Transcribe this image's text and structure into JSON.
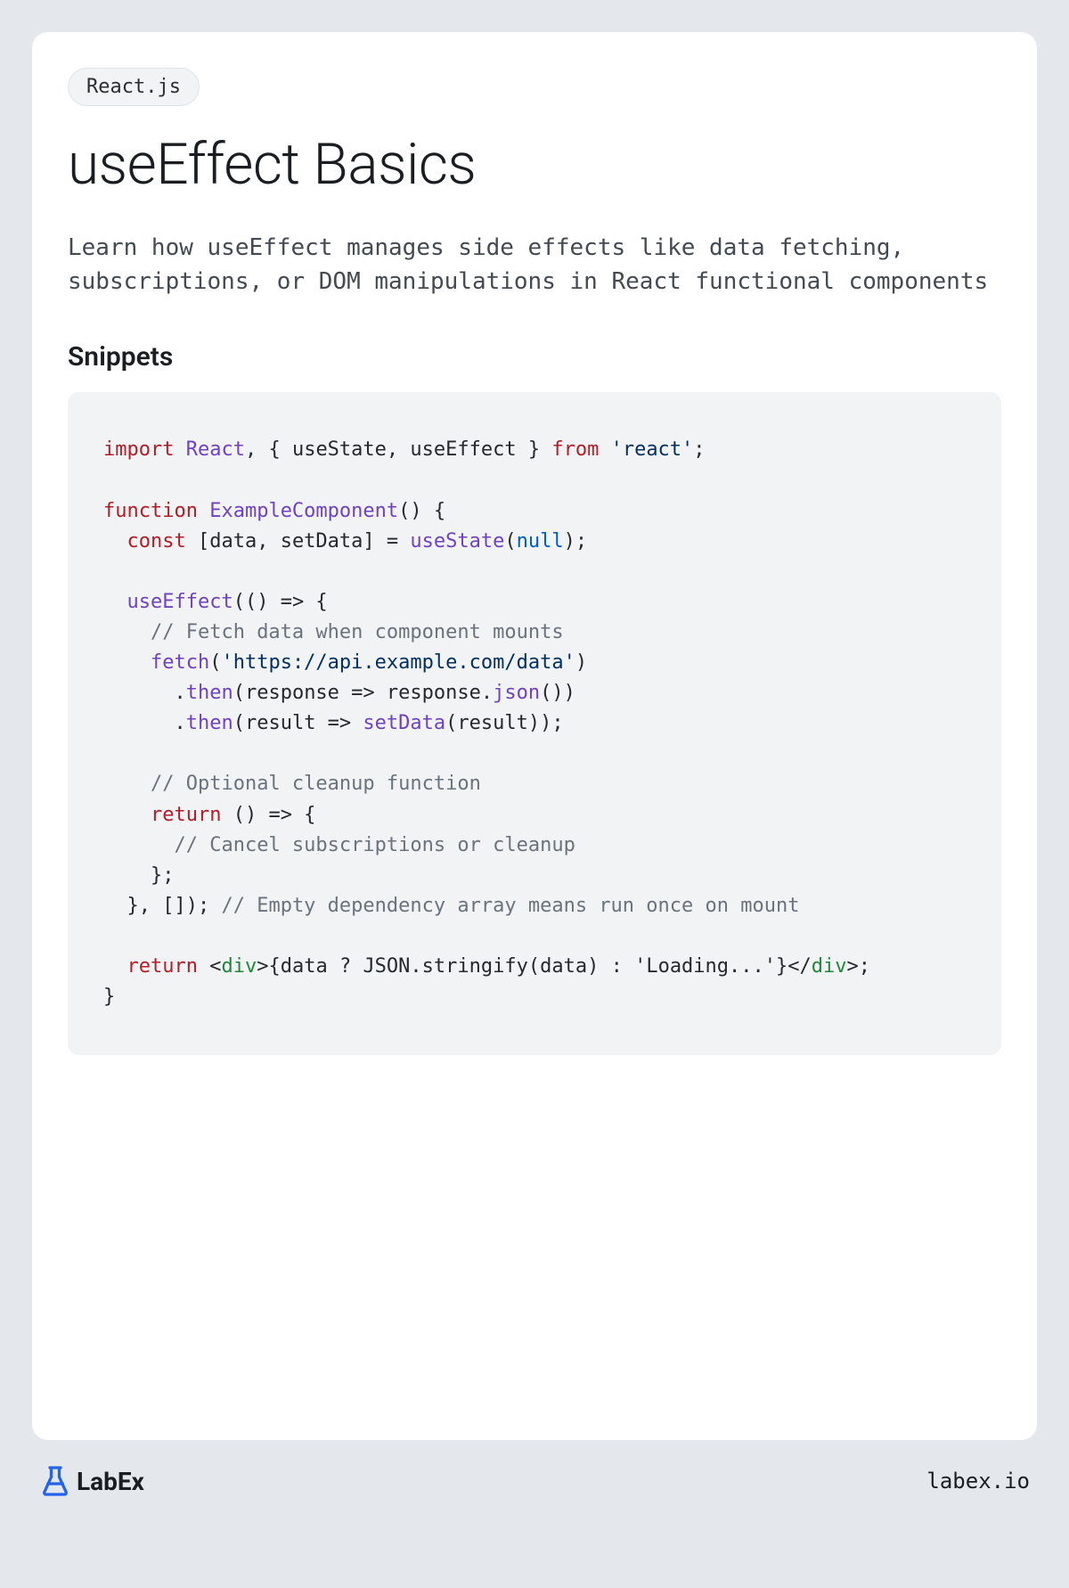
{
  "tag": "React.js",
  "title": "useEffect Basics",
  "description": "Learn how useEffect manages side effects like data fetching, subscriptions, or DOM manipulations in React functional components",
  "section_heading": "Snippets",
  "code": {
    "l1_import": "import",
    "l1_react": "React",
    "l1_rest": ", { useState, useEffect } ",
    "l1_from": "from",
    "l1_str": "'react'",
    "l3_function": "function",
    "l3_name": "ExampleComponent",
    "l3_rest": "() {",
    "l4_const": "const",
    "l4_mid": " [data, setData] = ",
    "l4_usestate": "useState",
    "l4_open": "(",
    "l4_null": "null",
    "l4_close": ");",
    "l6_call": "useEffect",
    "l6_rest": "(() => {",
    "l7_comment": "// Fetch data when component mounts",
    "l8_fetch": "fetch",
    "l8_open": "(",
    "l8_str": "'https://api.example.com/data'",
    "l8_close": ")",
    "l9_pre": "      .",
    "l9_then": "then",
    "l9_mid": "(response => response.",
    "l9_json": "json",
    "l9_end": "())",
    "l10_pre": "      .",
    "l10_then": "then",
    "l10_mid": "(result => ",
    "l10_setdata": "setData",
    "l10_end": "(result));",
    "l12_comment": "// Optional cleanup function",
    "l13_return": "return",
    "l13_rest": " () => {",
    "l14_comment": "// Cancel subscriptions or cleanup",
    "l15": "    };",
    "l16_pre": "  }, []); ",
    "l16_comment": "// Empty dependency array means run once on mount",
    "l18_return": "return",
    "l18_open": " <",
    "l18_div": "div",
    "l18_mid": ">{data ? JSON.stringify(data) : 'Loading...'}</",
    "l18_div2": "div",
    "l18_close": ">;",
    "l19": "}"
  },
  "logo_text": "LabEx",
  "footer_url": "labex.io"
}
